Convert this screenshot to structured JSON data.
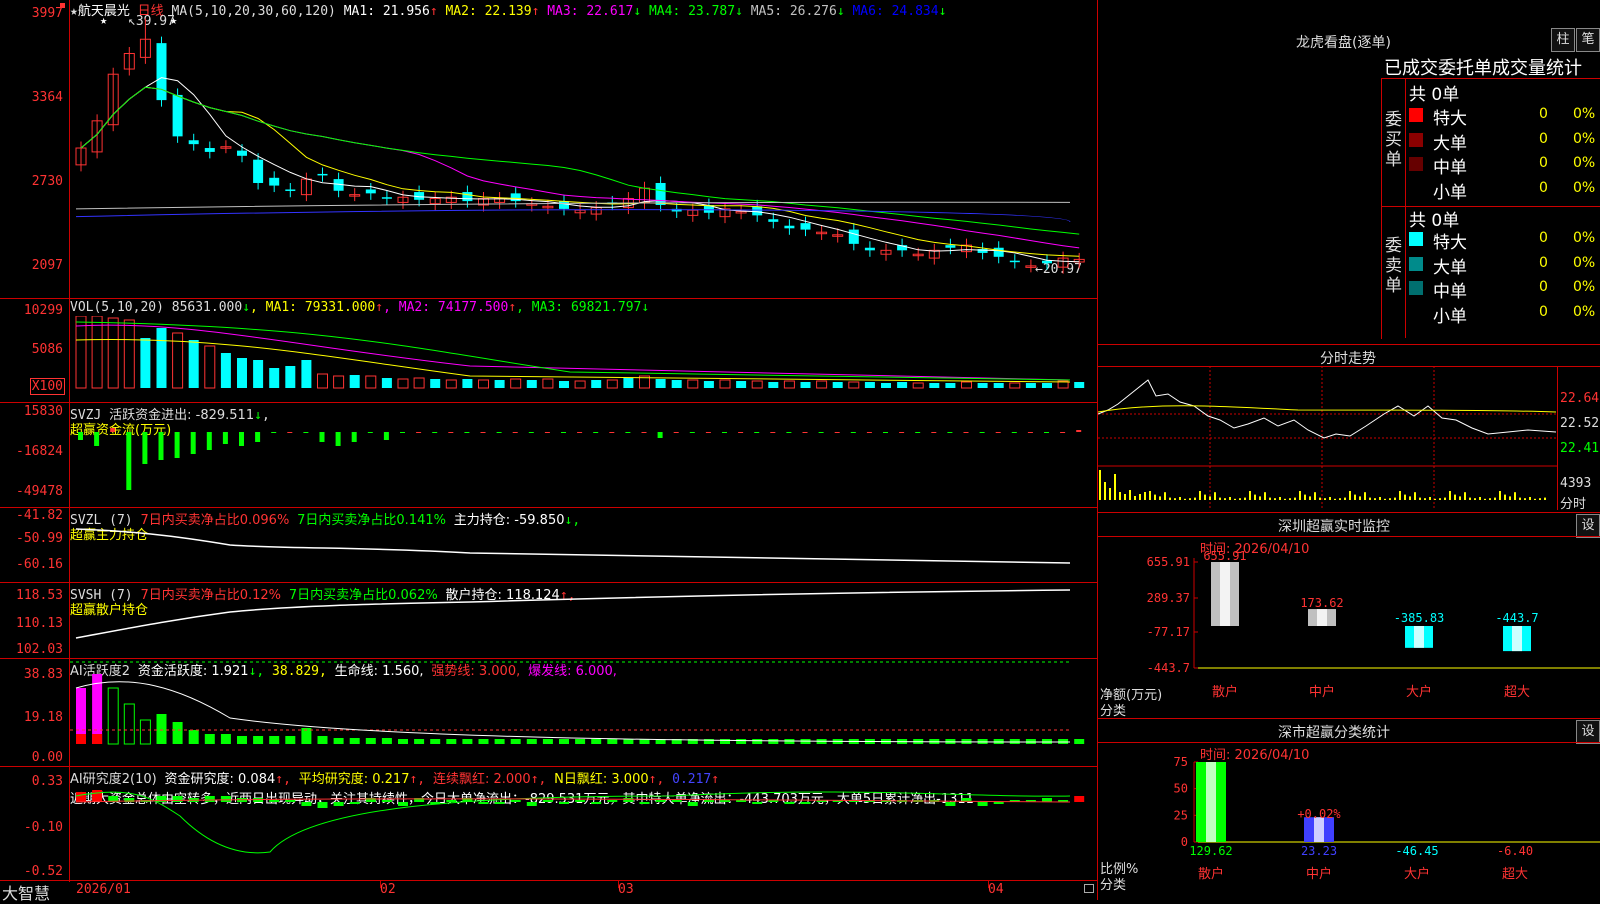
{
  "stock": {
    "name": "航天晨光",
    "period": "日线",
    "star": "★"
  },
  "price_panel": {
    "ma_label": "MA(5,10,20,30,60,120)",
    "mas": [
      {
        "label": "MA1: 21.956",
        "arrow": "↑",
        "color": "#ffffff"
      },
      {
        "label": "MA2: 22.139",
        "arrow": "↑",
        "color": "#ffff00"
      },
      {
        "label": "MA3: 22.617",
        "arrow": "↓",
        "color": "#ff00ff"
      },
      {
        "label": "MA4: 23.787",
        "arrow": "↓",
        "color": "#00ff00"
      },
      {
        "label": "MA5: 26.276",
        "arrow": "↓",
        "color": "#c0c0c0"
      },
      {
        "label": "MA6: 24.834",
        "arrow": "↓",
        "color": "#0000ff"
      }
    ],
    "y_ticks": [
      "3997",
      "3364",
      "2730",
      "2097"
    ],
    "high_label": "39.97",
    "low_label": "20.97"
  },
  "vol_panel": {
    "header": "VOL(5,10,20)",
    "value": "85631.000",
    "value_arrow": "↓",
    "mas": [
      {
        "label": "MA1: 79331.000",
        "arrow": "↑",
        "color": "#ffff00"
      },
      {
        "label": "MA2: 74177.500",
        "arrow": "↑",
        "color": "#ff00ff"
      },
      {
        "label": "MA3: 69821.797",
        "arrow": "↓",
        "color": "#00ff00"
      }
    ],
    "y_ticks": [
      "10299",
      "5086"
    ],
    "unit": "X100"
  },
  "svzj_panel": {
    "header": "SVZJ",
    "item": "活跃资金进出: -829.511",
    "arrow": "↓",
    "sub": "超赢资金流(万元)",
    "y_ticks": [
      "15830",
      "-16824",
      "-49478"
    ]
  },
  "svzl_panel": {
    "header": "SVZL (7)",
    "i1": "7日内买卖净占比0.096%",
    "i2": "7日内买卖净占比0.141%",
    "i3": "主力持仓: -59.850",
    "arrow": "↓,",
    "sub": "超赢主力持仓",
    "y_ticks": [
      "-41.82",
      "-50.99",
      "-60.16"
    ]
  },
  "svsh_panel": {
    "header": "SVSH (7)",
    "i1": "7日内买卖净占比0.12%",
    "i2": "7日内买卖净占比0.062%",
    "i3": "散户持仓: 118.124",
    "arrow": "↑,",
    "sub": "超赢散户持仓",
    "y_ticks": [
      "118.53",
      "110.13",
      "102.03"
    ]
  },
  "ai_active_panel": {
    "header": "AI活跃度2",
    "i1": "资金活跃度: 1.921",
    "i1_arrow": "↓,",
    "i2": "38.829,",
    "i3": "生命线: 1.560,",
    "i4": "强势线: 3.000,",
    "i5": "爆发线: 6.000,",
    "y_ticks": [
      "38.83",
      "19.18",
      "0.00"
    ]
  },
  "ai_research_panel": {
    "header": "AI研究度2(10)",
    "i1": "资金研究度: 0.084",
    "i1_arrow": "↑,",
    "i2": "平均研究度: 0.217",
    "i2_arrow": "↑,",
    "i3": "连续飘红: 2.000",
    "i3_arrow": "↑,",
    "i4": "N日飘红: 3.000",
    "i4_arrow": "↑,",
    "i5": "0.217",
    "i5_arrow": "↑",
    "commentary": "近期大资金总体由空转多，近两日出现异动，关注其持续性，今日大单净流出：-829.531万元，其中特大单净流出：-443.703万元，大单5日累计净出-1311",
    "y_ticks": [
      "0.33",
      "-0.10",
      "-0.52"
    ]
  },
  "x_axis": {
    "labels": [
      "2026/01",
      "02",
      "03",
      "04"
    ],
    "brand": "大智慧"
  },
  "dragon_tiger": {
    "title": "龙虎看盘(逐单)",
    "btn1": "柱",
    "btn2": "笔",
    "table_title": "已成交委托单成交量统计",
    "buy": {
      "side_label": "委买单",
      "total": "共 0单",
      "rows": [
        {
          "label": "特大",
          "count": "0",
          "pct": "0%",
          "color": "#ff0000"
        },
        {
          "label": "大单",
          "count": "0",
          "pct": "0%",
          "color": "#8b0000"
        },
        {
          "label": "中单",
          "count": "0",
          "pct": "0%",
          "color": "#660000"
        },
        {
          "label": "小单",
          "count": "0",
          "pct": "0%",
          "color": ""
        }
      ]
    },
    "sell": {
      "side_label": "委卖单",
      "total": "共 0单",
      "rows": [
        {
          "label": "特大",
          "count": "0",
          "pct": "0%",
          "color": "#00ffff"
        },
        {
          "label": "大单",
          "count": "0",
          "pct": "0%",
          "color": "#008b8b"
        },
        {
          "label": "中单",
          "count": "0",
          "pct": "0%",
          "color": "#006f6f"
        },
        {
          "label": "小单",
          "count": "0",
          "pct": "0%",
          "color": ""
        }
      ]
    }
  },
  "intraday": {
    "title": "分时走势",
    "prices": [
      "22.64",
      "22.52",
      "22.41"
    ],
    "vol": "4393",
    "vol_unit": "分时"
  },
  "sz_monitor": {
    "title": "深圳超赢实时监控",
    "btn": "设",
    "time": "时间: 2026/04/10",
    "y_ticks": [
      "655.91",
      "289.37",
      "-77.17",
      "-443.7"
    ],
    "y_unit": "净额(万元)",
    "x_title": "分类",
    "chart_data": {
      "type": "bar",
      "categories": [
        "散户",
        "中户",
        "大户",
        "超大"
      ],
      "values": [
        655.91,
        173.62,
        -385.83,
        -443.7
      ],
      "value_labels": [
        "655.91",
        "173.62",
        "-385.83",
        "-443.7"
      ],
      "ylim": [
        -443.7,
        655.91
      ],
      "colors": [
        "#c0c0c0",
        "#c0c0c0",
        "#00ffff",
        "#00ffff"
      ]
    }
  },
  "sz_category": {
    "title": "深市超赢分类统计",
    "btn": "设",
    "time": "时间: 2026/04/10",
    "y_ticks": [
      "75",
      "50",
      "25",
      "0"
    ],
    "y_unit": "比例%",
    "x_title": "分类",
    "extra_label": "+0.02%",
    "chart_data": {
      "type": "bar",
      "categories": [
        "散户",
        "中户",
        "大户",
        "超大"
      ],
      "values": [
        129.62,
        23.23,
        -46.45,
        -6.4
      ],
      "value_labels": [
        "129.62",
        "23.23",
        "-46.45",
        "-6.40"
      ],
      "ylim": [
        0,
        75
      ],
      "colors": [
        "#00ff00",
        "#4040ff",
        "#00ffff",
        "#ff4040"
      ]
    }
  }
}
